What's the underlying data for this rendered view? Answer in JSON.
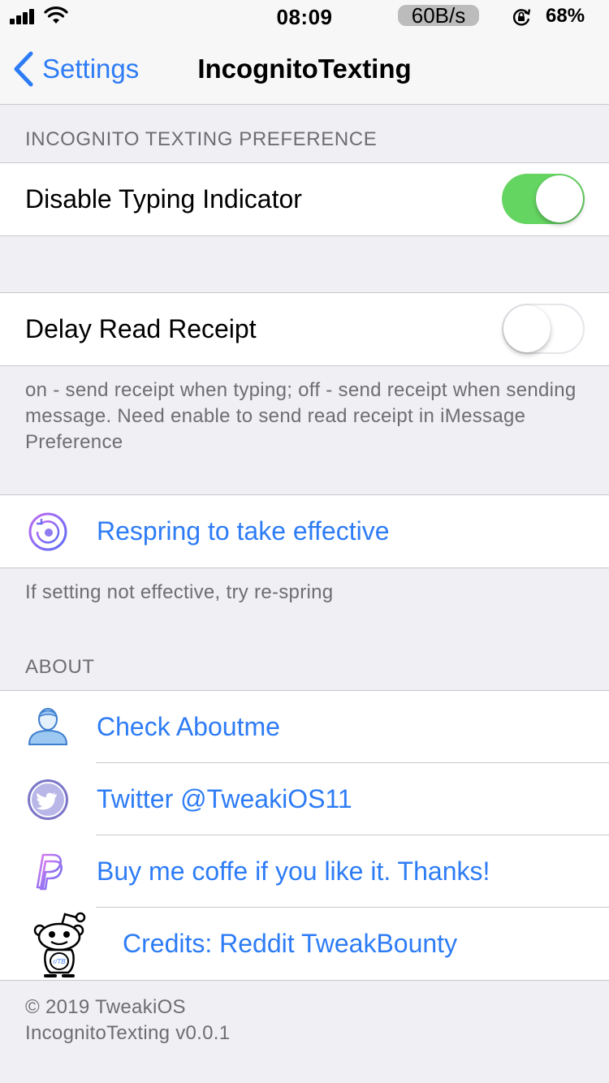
{
  "status_bar": {
    "time": "08:09",
    "net_speed": "60B/s",
    "battery": "68%"
  },
  "nav": {
    "back_label": "Settings",
    "title": "IncognitoTexting"
  },
  "sections": {
    "pref_header": "INCOGNITO TEXTING PREFERENCE",
    "disable_typing": {
      "label": "Disable Typing Indicator",
      "on": true
    },
    "delay_read": {
      "label": "Delay Read Receipt",
      "on": false
    },
    "delay_footer": "on - send receipt when typing; off - send receipt when sending message. Need enable to send read receipt in iMessage Preference",
    "respring": {
      "label": "Respring to take effective"
    },
    "respring_footer": "If setting not effective, try re-spring",
    "about_header": "ABOUT",
    "about_items": [
      {
        "label": "Check Aboutme"
      },
      {
        "label": "Twitter @TweakiOS11"
      },
      {
        "label": "Buy me coffe if you like it. Thanks!"
      },
      {
        "label": "Credits: Reddit TweakBounty"
      }
    ],
    "copyright": "© 2019 TweakiOS",
    "version": "IncognitoTexting v0.0.1"
  },
  "colors": {
    "accent": "#2d7cf6",
    "toggle_on": "#65d562",
    "background": "#efeff4"
  },
  "icons": {
    "respring": "respring-icon",
    "about": "person-icon",
    "twitter": "twitter-bird-icon",
    "paypal": "paypal-icon",
    "reddit": "reddit-alien-icon"
  }
}
